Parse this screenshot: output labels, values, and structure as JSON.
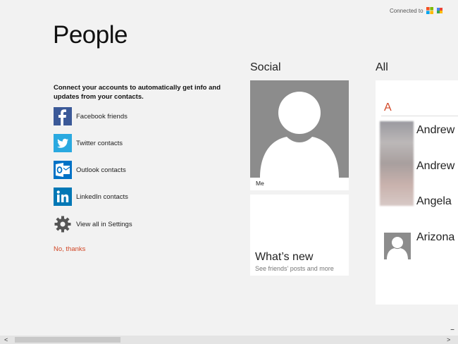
{
  "header": {
    "connected_label": "Connected to",
    "services": [
      {
        "icon": "microsoft-logo-icon"
      },
      {
        "icon": "google-logo-icon"
      }
    ],
    "title": "People"
  },
  "connect": {
    "intro": "Connect your accounts to automatically get info and updates from your contacts.",
    "accounts": [
      {
        "label": "Facebook friends",
        "icon": "facebook-icon",
        "color": "#3b5998"
      },
      {
        "label": "Twitter contacts",
        "icon": "twitter-icon",
        "color": "#2aa9e0"
      },
      {
        "label": "Outlook contacts",
        "icon": "outlook-icon",
        "color": "#0072c6"
      },
      {
        "label": "LinkedIn contacts",
        "icon": "linkedin-icon",
        "color": "#0077b5"
      },
      {
        "label": "View all in Settings",
        "icon": "gear-icon",
        "color": "#555555"
      }
    ],
    "no_thanks": "No, thanks"
  },
  "social": {
    "heading": "Social",
    "me_label": "Me",
    "whats_new_title": "What’s new",
    "whats_new_sub": "See friends’ posts and more"
  },
  "all": {
    "heading": "All",
    "letter": "A",
    "contacts": [
      "Andrew",
      "Andrew",
      "Angela",
      "Arizona"
    ]
  },
  "colors": {
    "accent": "#d24726",
    "background": "#f2f2f2",
    "avatar_gray": "#8c8c8c"
  },
  "scroll": {
    "left_arrow": "<",
    "right_arrow": ">",
    "zoom": "−"
  }
}
